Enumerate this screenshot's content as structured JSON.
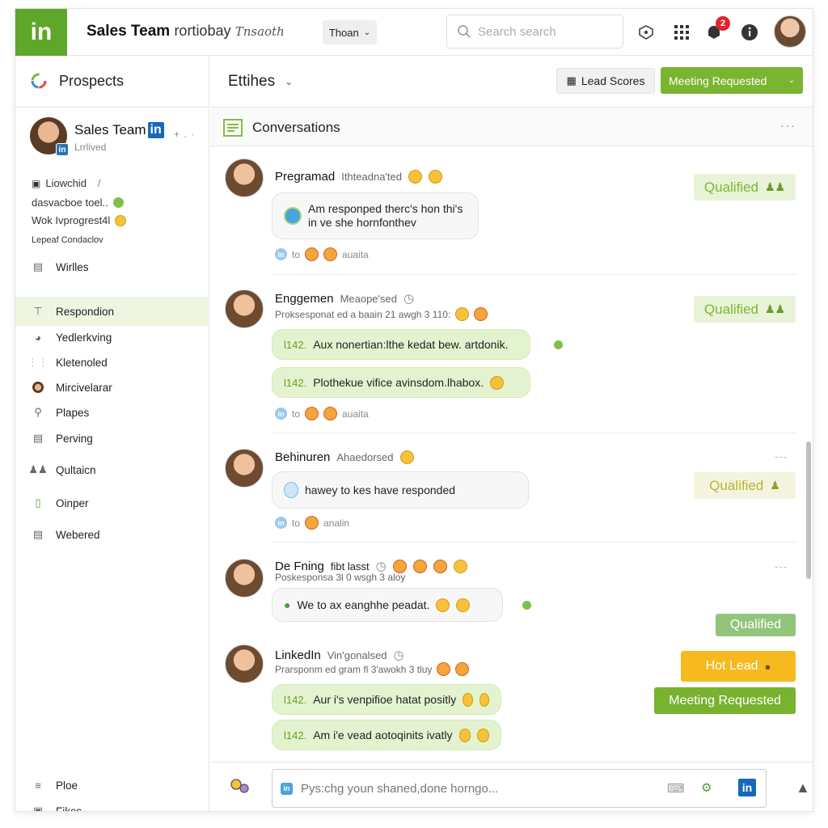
{
  "app": {
    "logo_text": "in",
    "title": "Sales Team",
    "title_sub": "rortiobay",
    "title_sub2": "Tnsaoth",
    "filter_dropdown": "Thoan",
    "search_placeholder": "Search search",
    "notification_count": "2",
    "brand_color": "#5ea72a"
  },
  "sidebar": {
    "section_title": "Prospects",
    "profile": {
      "name": "Sales Team",
      "badge": "in",
      "dots": "+ . ·",
      "subtitle": "Lrrlived"
    },
    "meta": [
      {
        "text": "Liowchid",
        "suffix": "/"
      },
      {
        "text": "dasvacboe toel.."
      },
      {
        "text": "Wok Ivprogrest4l"
      },
      {
        "text": "Lepeaf Condaclov"
      }
    ],
    "items": [
      {
        "label": "Wirlles",
        "icon": "list-icon"
      },
      {
        "label": "Respondion",
        "icon": "tag-icon",
        "active": true
      },
      {
        "label": "Yedlerkving",
        "icon": "globe-icon"
      },
      {
        "label": "Kletenoled",
        "icon": "dots-icon"
      },
      {
        "label": "Mircivelarar",
        "icon": "user-dot-icon"
      },
      {
        "label": "Plapes",
        "icon": "pin-icon"
      },
      {
        "label": "Perving",
        "icon": "clipboard-icon"
      },
      {
        "label": "Qultaicn",
        "icon": "people-icon"
      },
      {
        "label": "Oinper",
        "icon": "phone-icon"
      },
      {
        "label": "Webered",
        "icon": "document-icon"
      }
    ],
    "bottom_items": [
      {
        "label": "Ploe",
        "icon": "stack-icon"
      },
      {
        "label": "Fikes",
        "icon": "lock-icon"
      }
    ]
  },
  "header": {
    "view_label": "Ettihes",
    "lead_scores": "Lead Scores",
    "meeting_requested": "Meeting Requested"
  },
  "conversations": {
    "title": "Conversations",
    "more": "···",
    "messages": [
      {
        "name": "Pregramad",
        "role": "Ithteadna'ted",
        "bubbles": [
          {
            "text": "Am responped therc's hon thi's in ve she hornfonthev",
            "green": false
          }
        ],
        "foot_to": "to",
        "foot_status": "auaita",
        "tag": "Qualified"
      },
      {
        "name": "Enggemen",
        "role": "Meaope'sed",
        "sub": "Proksesponat ed a baain 21 awgh 3 110:",
        "bubbles": [
          {
            "num": "l142.",
            "text": "Aux nonertian:lthe kedat bew. artdonik.",
            "green": true
          },
          {
            "num": "l142.",
            "text": "Plothekue vifice avinsdom.lhabox.",
            "green": true
          }
        ],
        "foot_to": "to",
        "foot_status": "auaita",
        "tag": "Qualified"
      },
      {
        "name": "Behinuren",
        "role": "Ahaedorsed",
        "bubbles": [
          {
            "text": "hawey to kes have responded",
            "green": false
          }
        ],
        "foot_to": "to",
        "foot_status": "analin",
        "tag": "Qualified"
      },
      {
        "name": "De Fning",
        "role": "fibt lasst",
        "sub": "Poskesponsa 3l 0 wsgh 3 aloy",
        "bubbles": [
          {
            "text": "We to ax eanghhe peadat.",
            "green": false
          }
        ],
        "tag": "Qualified"
      },
      {
        "name": "LinkedIn",
        "role": "Vin'gonalsed",
        "sub": "Prarsponm ed gram fl 3'awokh 3 tluy",
        "bubbles": [
          {
            "num": "l142.",
            "text": "Aur i's venpifioe hatat positly",
            "green": true
          },
          {
            "num": "l142.",
            "text": "Am i'e vead aotoqinits ivatly",
            "green": true
          }
        ],
        "tags": [
          "Hot Lead",
          "Meeting Requested"
        ]
      }
    ]
  },
  "composer": {
    "placeholder": "Pys:chg youn shaned,done horngo..."
  }
}
